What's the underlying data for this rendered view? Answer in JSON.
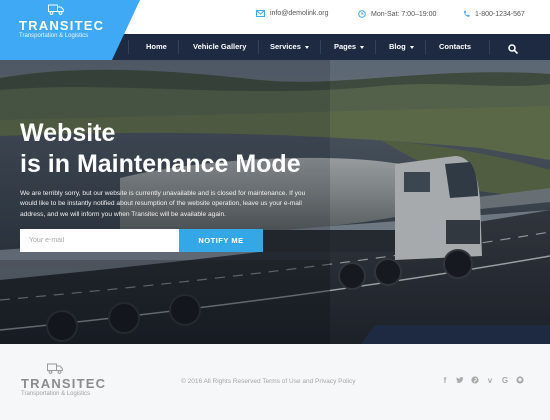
{
  "brand": {
    "name": "TRANSITEC",
    "tagline": "Transportation & Logistics",
    "accent_color": "#3fa9f5",
    "nav_color": "#1d2a41"
  },
  "contact": {
    "email": "info@demolink.org",
    "hours": "Mon-Sat: 7:00–19:00",
    "phone": "1-800-1234-567"
  },
  "nav": {
    "items": [
      {
        "label": "Home"
      },
      {
        "label": "Vehicle Gallery"
      },
      {
        "label": "Services",
        "dropdown": true
      },
      {
        "label": "Pages",
        "dropdown": true
      },
      {
        "label": "Blog",
        "dropdown": true
      },
      {
        "label": "Contacts"
      }
    ],
    "search_icon": "search-icon"
  },
  "hero": {
    "title_line1": "Website",
    "title_line2": "is in Maintenance Mode",
    "text": "We are terribly sorry, but our website is currently unavailable and is closed for maintenance. If you would like to be instantly notified about resumption of the website operation, leave us your e-mail address, and we will inform you when Transitec will be available again.",
    "email_placeholder": "Your e-mail",
    "button_label": "NOTIFY ME"
  },
  "footer": {
    "brand_name": "TRANSITEC",
    "brand_tagline": "Transportation & Logistics",
    "copyright": "© 2016 All Rights Reserved Terms of Use and Privacy Policy",
    "socials": [
      "facebook-icon",
      "twitter-icon",
      "pinterest-icon",
      "vimeo-icon",
      "google-plus-icon",
      "github-icon"
    ]
  }
}
